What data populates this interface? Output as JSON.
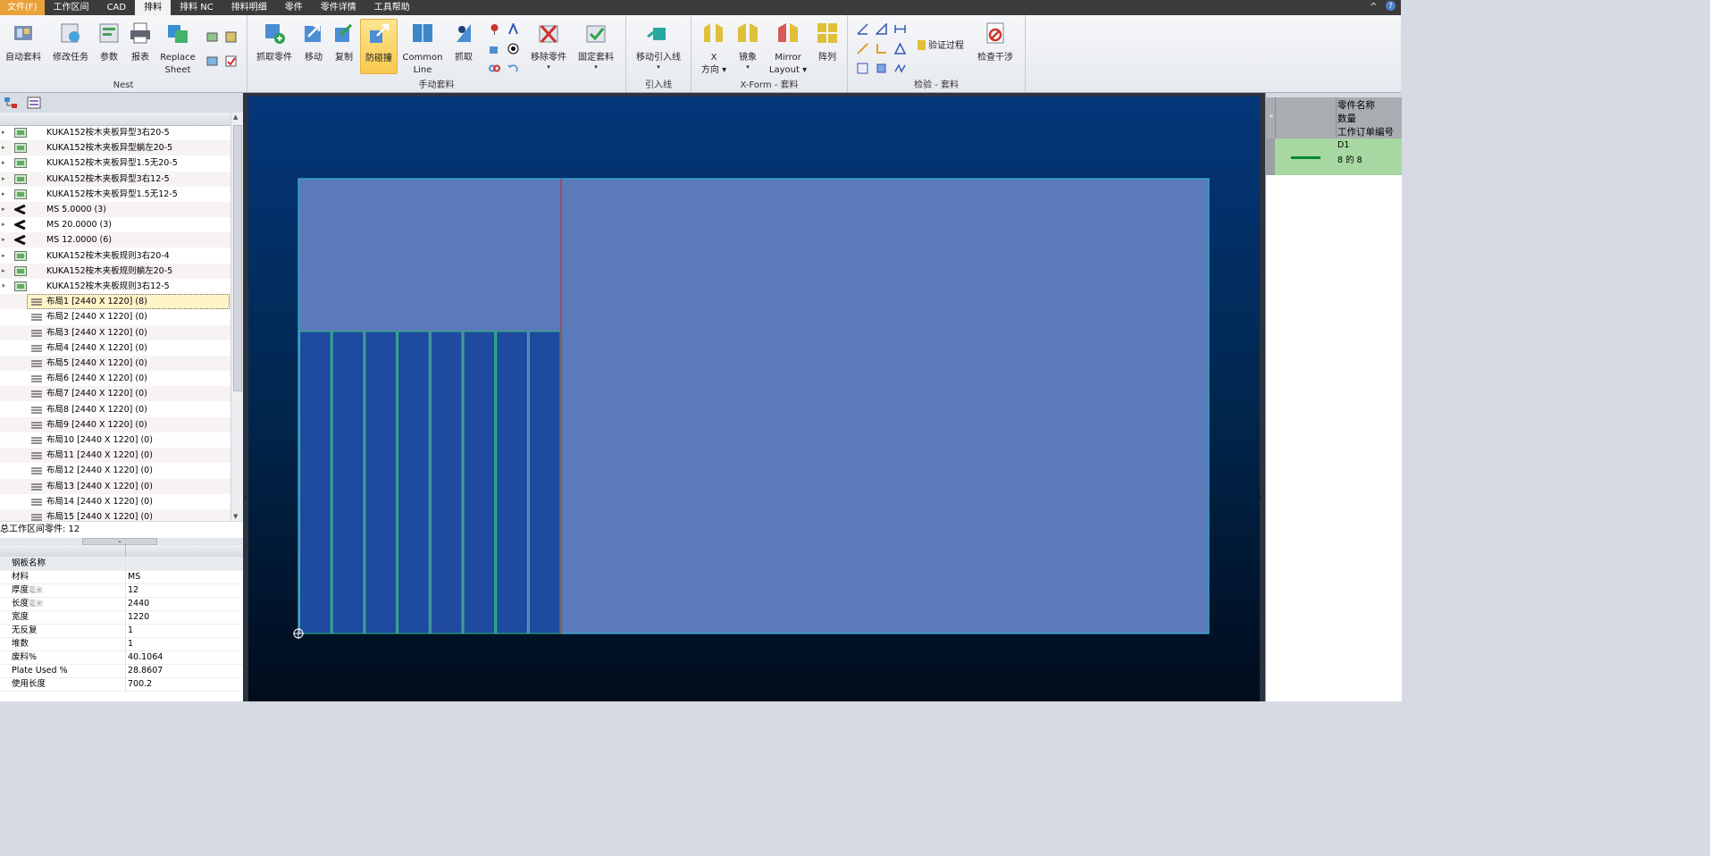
{
  "menu": {
    "items": [
      "文件(F)",
      "工作区间",
      "CAD",
      "排料",
      "排料 NC",
      "排料明细",
      "零件",
      "零件详情",
      "工具帮助"
    ],
    "active_index": 3,
    "minimize": "^",
    "help": "?"
  },
  "ribbon": {
    "groups": {
      "nest": "Nest",
      "manual": "手动套料",
      "lead": "引入线",
      "xform": "X-Form - 套料",
      "check": "检验 - 套料"
    },
    "buttons": {
      "auto_nest": "自动套料",
      "modify_task": "修改任务",
      "params": "参数",
      "report": "报表",
      "replace_sheet_1": "Replace",
      "replace_sheet_2": "Sheet",
      "grab_part": "抓取零件",
      "move": "移动",
      "copy": "复制",
      "anti_collision": "防碰撞",
      "common_line_1": "Common",
      "common_line_2": "Line",
      "grab": "抓取",
      "remove_part": "移除零件",
      "fix_nest": "固定套料",
      "move_lead": "移动引入线",
      "x_dir_1": "X",
      "x_dir_2": "方向",
      "mirror": "镜象",
      "mirror_layout_1": "Mirror",
      "mirror_layout_2": "Layout",
      "array": "阵列",
      "verify_process": "验证过程",
      "check_interference": "检查干涉"
    }
  },
  "tree": {
    "rows": [
      {
        "label": "KUKA152桉木夹板异型3右20-5",
        "icon": "part-image-icon",
        "expand": "▸"
      },
      {
        "label": "KUKA152桉木夹板异型躺左20-5",
        "icon": "part-image-icon",
        "expand": "▸"
      },
      {
        "label": "KUKA152桉木夹板异型1.5无20-5",
        "icon": "part-image-icon",
        "expand": "▸"
      },
      {
        "label": "KUKA152桉木夹板异型3右12-5",
        "icon": "part-image-icon",
        "expand": "▸"
      },
      {
        "label": "KUKA152桉木夹板异型1.5无12-5",
        "icon": "part-image-icon",
        "expand": "▸"
      },
      {
        "label": "MS 5.0000 (3)",
        "icon": "material-icon",
        "expand": "▸"
      },
      {
        "label": "MS 20.0000 (3)",
        "icon": "material-icon",
        "expand": "▸"
      },
      {
        "label": "MS 12.0000 (6)",
        "icon": "material-icon",
        "expand": "▸"
      },
      {
        "label": "KUKA152桉木夹板规则3右20-4",
        "icon": "part-image-icon",
        "expand": "▸"
      },
      {
        "label": "KUKA152桉木夹板规则躺左20-5",
        "icon": "part-image-icon",
        "expand": "▸"
      },
      {
        "label": "KUKA152桉木夹板规则3右12-5",
        "icon": "part-image-icon",
        "expand": "▾"
      }
    ],
    "layouts": [
      "布局1 [2440 X 1220]  (8)",
      "布局2 [2440 X 1220]  (0)",
      "布局3 [2440 X 1220]  (0)",
      "布局4 [2440 X 1220]  (0)",
      "布局5 [2440 X 1220]  (0)",
      "布局6 [2440 X 1220]  (0)",
      "布局7 [2440 X 1220]  (0)",
      "布局8 [2440 X 1220]  (0)",
      "布局9 [2440 X 1220]  (0)",
      "布局10 [2440 X 1220]  (0)",
      "布局11 [2440 X 1220]  (0)",
      "布局12 [2440 X 1220]  (0)",
      "布局13 [2440 X 1220]  (0)",
      "布局14 [2440 X 1220]  (0)",
      "布局15 [2440 X 1220]  (0)"
    ],
    "selected_layout_index": 0
  },
  "summary": "总工作区间零件: 12",
  "props": {
    "rows": [
      {
        "k": "钢板名称",
        "v": "",
        "unit": ""
      },
      {
        "k": "材料",
        "v": "MS",
        "unit": ""
      },
      {
        "k": "厚度",
        "v": "12",
        "unit": "毫米"
      },
      {
        "k": "长度",
        "v": "2440",
        "unit": "毫米"
      },
      {
        "k": "宽度",
        "v": "1220",
        "unit": ""
      },
      {
        "k": "无反复",
        "v": "1",
        "unit": ""
      },
      {
        "k": "堆数",
        "v": "1",
        "unit": ""
      },
      {
        "k": "废料%",
        "v": "40.1064",
        "unit": ""
      },
      {
        "k": "Plate Used %",
        "v": "28.8607",
        "unit": ""
      },
      {
        "k": "使用长度",
        "v": "700.2",
        "unit": ""
      }
    ]
  },
  "canvas": {
    "sheet_color": "#5b7aba",
    "sheet_border": "#30c8e0",
    "part_color": "#1e4aa0",
    "part_border": "#2fb87a",
    "cut_line_color": "#c0303a",
    "part_count": 8
  },
  "right_panel": {
    "headers": [
      "零件名称",
      "数量",
      "工作订单编号"
    ],
    "star": "*",
    "row": {
      "name": "D1",
      "qty": "8 的 8",
      "line_color": "#008a2e",
      "bg": "#a7d8a1"
    }
  }
}
